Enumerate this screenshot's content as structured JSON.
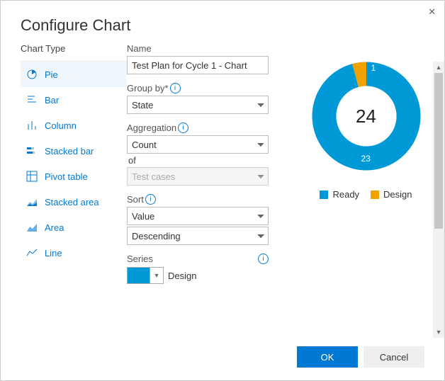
{
  "header": {
    "title": "Configure Chart"
  },
  "chart_type": {
    "label": "Chart Type",
    "items": [
      {
        "id": "pie",
        "label": "Pie",
        "selected": true
      },
      {
        "id": "bar",
        "label": "Bar",
        "selected": false
      },
      {
        "id": "column",
        "label": "Column",
        "selected": false
      },
      {
        "id": "stacked-bar",
        "label": "Stacked bar",
        "selected": false
      },
      {
        "id": "pivot-table",
        "label": "Pivot table",
        "selected": false
      },
      {
        "id": "stacked-area",
        "label": "Stacked area",
        "selected": false
      },
      {
        "id": "area",
        "label": "Area",
        "selected": false
      },
      {
        "id": "line",
        "label": "Line",
        "selected": false
      }
    ]
  },
  "form": {
    "name_label": "Name",
    "name_value": "Test Plan for Cycle 1 - Chart",
    "group_by_label": "Group by*",
    "group_by_value": "State",
    "aggregation_label": "Aggregation",
    "aggregation_value": "Count",
    "of_label": "of",
    "of_value": "Test cases",
    "sort_label": "Sort",
    "sort_field_value": "Value",
    "sort_dir_value": "Descending",
    "series_label": "Series",
    "series_color": "#0099d8",
    "series_name": "Design"
  },
  "buttons": {
    "ok": "OK",
    "cancel": "Cancel"
  },
  "colors": {
    "ready": "#0099d8",
    "design": "#f2a200",
    "primary": "#0078d4"
  },
  "chart_data": {
    "type": "pie",
    "title": "",
    "categories": [
      "Ready",
      "Design"
    ],
    "values": [
      23,
      1
    ],
    "total": 24,
    "series": [
      {
        "name": "Ready",
        "value": 23,
        "color": "#0099d8"
      },
      {
        "name": "Design",
        "value": 1,
        "color": "#f2a200"
      }
    ]
  }
}
